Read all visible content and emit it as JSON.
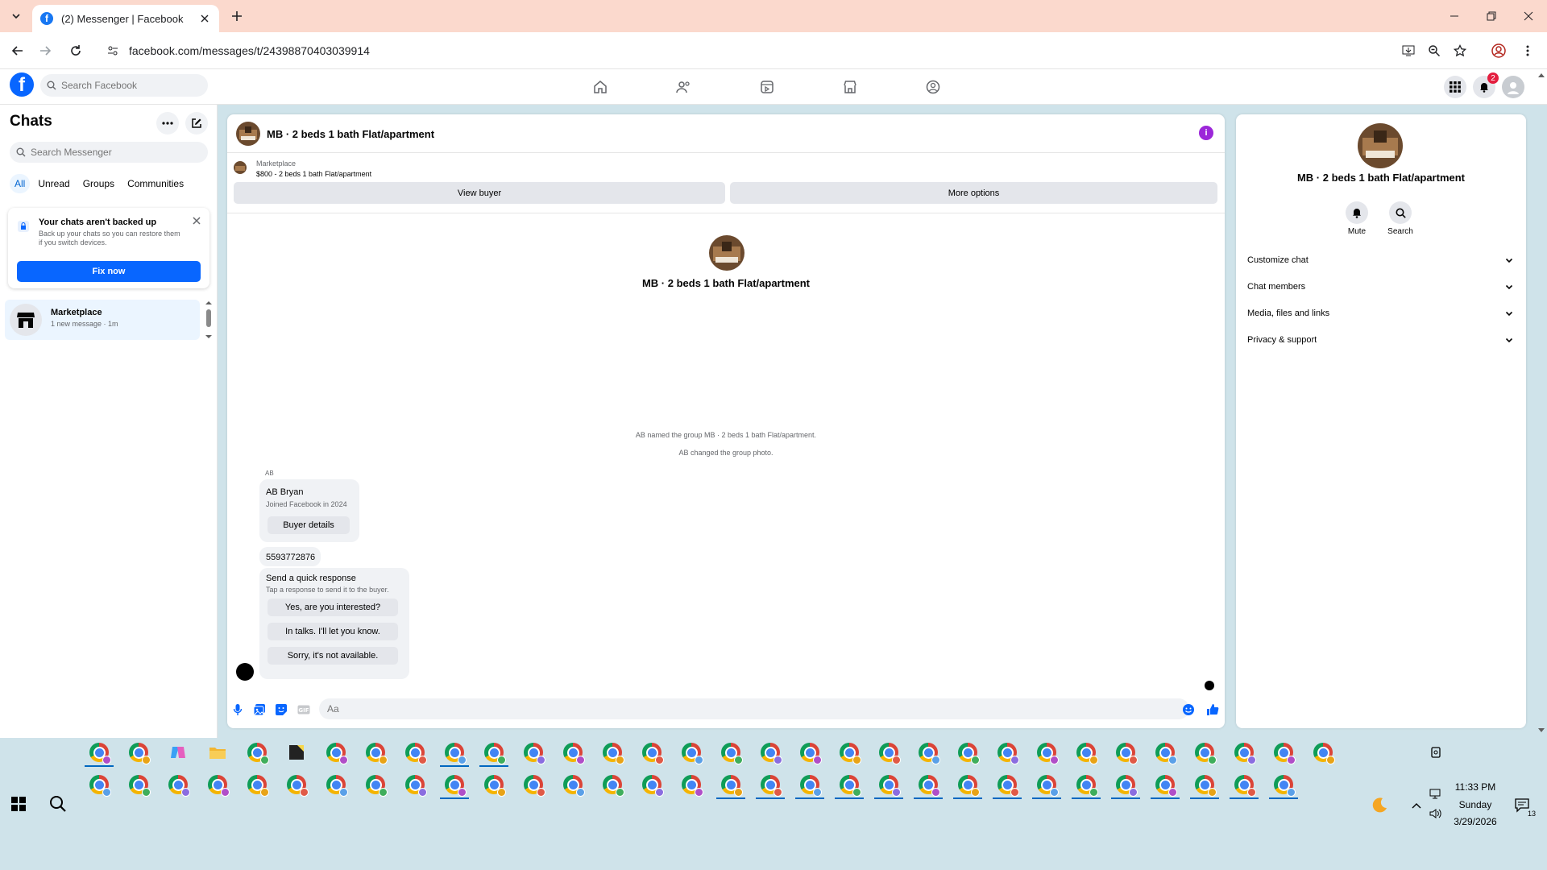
{
  "browser": {
    "tab_title": "(2) Messenger | Facebook",
    "url": "facebook.com/messages/t/24398870403039914"
  },
  "fb": {
    "search_placeholder": "Search Facebook",
    "notification_count": "2"
  },
  "sidebar": {
    "title": "Chats",
    "search_placeholder": "Search Messenger",
    "filters": [
      "All",
      "Unread",
      "Groups",
      "Communities"
    ],
    "backup": {
      "title": "Your chats aren't backed up",
      "description": "Back up your chats so you can restore them if you switch devices.",
      "button": "Fix now"
    },
    "chat_item": {
      "name": "Marketplace",
      "meta": "1 new message · 1m"
    }
  },
  "conversation": {
    "title": "MB · 2 beds 1 bath Flat/apartment",
    "marketplace_label": "Marketplace",
    "listing": "$800 - 2 beds 1 bath Flat/apartment",
    "view_buyer": "View buyer",
    "more_options": "More options",
    "center_title": "MB · 2 beds 1 bath Flat/apartment",
    "system_1": "AB named the group MB · 2 beds 1 bath Flat/apartment.",
    "system_2": "AB changed the group photo.",
    "sender": "AB",
    "buyer_name": "AB Bryan",
    "buyer_joined": "Joined Facebook in 2024",
    "buyer_details": "Buyer details",
    "phone": "5593772876",
    "quick_title": "Send a quick response",
    "quick_sub": "Tap a response to send it to the buyer.",
    "quick_responses": [
      "Yes, are you interested?",
      "In talks. I'll let you know.",
      "Sorry, it's not available."
    ],
    "composer_placeholder": "Aa"
  },
  "right_panel": {
    "title": "MB · 2 beds 1 bath Flat/apartment",
    "mute": "Mute",
    "search": "Search",
    "sections": [
      "Customize chat",
      "Chat members",
      "Media, files and links",
      "Privacy & support"
    ]
  },
  "taskbar": {
    "time": "11:33 PM",
    "day": "Sunday",
    "date": "3/29/2026",
    "notifications": "13"
  },
  "colors": {
    "facebook_blue": "#0866ff",
    "info_purple": "#9c27d9",
    "tab_bar": "#fbd9cd",
    "taskbar": "#cfe3ea"
  }
}
